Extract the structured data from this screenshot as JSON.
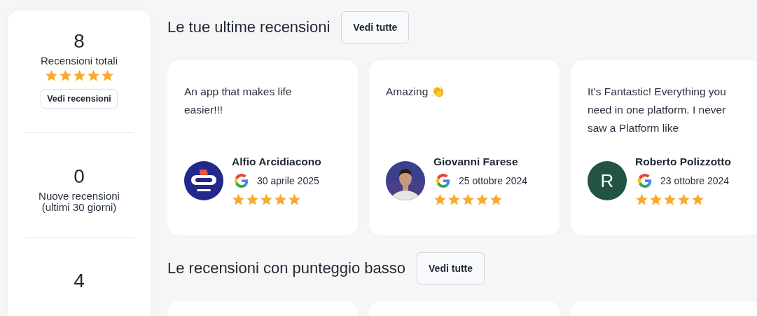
{
  "summary": [
    {
      "value": "8",
      "label": "Recensioni totali",
      "stars": 5,
      "button": "Vedi recensioni"
    },
    {
      "value": "0",
      "label": "Nuove recensioni (ultimi 30 giorni)"
    },
    {
      "value": "4"
    }
  ],
  "latest": {
    "title": "Le tue ultime recensioni",
    "button": "Vedi tutte",
    "reviews": [
      {
        "text": "An app that makes life easier!!!",
        "author": "Alfio Arcidiacono",
        "date": "30 aprile 2025",
        "stars": 5,
        "avatar": {
          "kind": "logo"
        }
      },
      {
        "text": "Amazing 👏",
        "author": "Giovanni Farese",
        "date": "25 ottobre 2024",
        "stars": 5
      },
      {
        "text": "It’s Fantastic! Everything you need in one platform. I never saw a Platform like",
        "author": "Roberto Polizzotto",
        "date": "23 ottobre 2024",
        "stars": 5,
        "avatar": {
          "kind": "initial",
          "letter": "R",
          "color": "#225343"
        }
      }
    ]
  },
  "low": {
    "title": "Le recensioni con punteggio basso",
    "button": "Vedi tutte",
    "reviews": [
      {
        "kind": "card"
      },
      {
        "kind": "card"
      },
      {
        "kind": "card"
      }
    ]
  }
}
